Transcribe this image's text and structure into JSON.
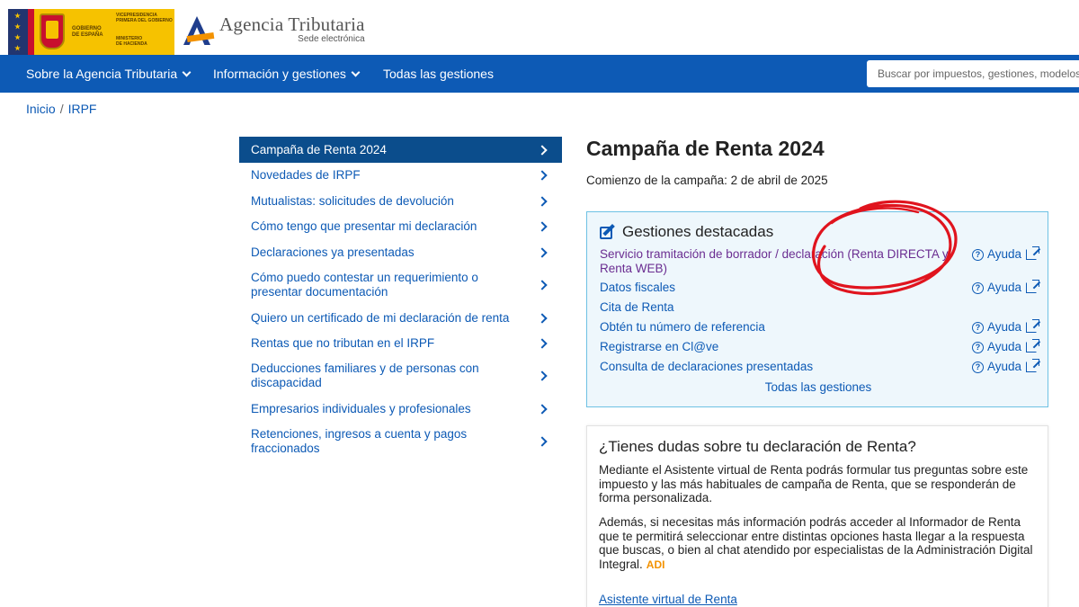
{
  "header": {
    "gov_logo": {
      "line1": "GOBIERNO",
      "line2": "DE ESPAÑA",
      "line3": "VICEPRESIDENCIA",
      "line4": "PRIMERA DEL GOBIERNO",
      "line5": "MINISTERIO",
      "line6": "DE HACIENDA"
    },
    "agency_name": "Agencia Tributaria",
    "agency_sub": "Sede electrónica"
  },
  "nav": {
    "items": [
      {
        "label": "Sobre la Agencia Tributaria",
        "has_dropdown": true
      },
      {
        "label": "Información y gestiones",
        "has_dropdown": true
      },
      {
        "label": "Todas las gestiones",
        "has_dropdown": false
      }
    ],
    "search_placeholder": "Buscar por impuestos, gestiones, modelos o c"
  },
  "breadcrumb": {
    "items": [
      "Inicio",
      "IRPF"
    ],
    "separator": "/"
  },
  "sidemenu": {
    "items": [
      {
        "label": "Campaña de Renta 2024",
        "active": true
      },
      {
        "label": "Novedades de IRPF"
      },
      {
        "label": "Mutualistas: solicitudes de devolución"
      },
      {
        "label": "Cómo tengo que presentar mi declaración"
      },
      {
        "label": "Declaraciones ya presentadas"
      },
      {
        "label": "Cómo puedo contestar un requerimiento o presentar documentación"
      },
      {
        "label": "Quiero un certificado de mi declaración de renta"
      },
      {
        "label": "Rentas que no tributan en el IRPF"
      },
      {
        "label": "Deducciones familiares y de personas con discapacidad"
      },
      {
        "label": "Empresarios individuales y profesionales"
      },
      {
        "label": "Retenciones, ingresos a cuenta y pagos fraccionados"
      }
    ]
  },
  "main": {
    "title": "Campaña de Renta 2024",
    "campaign_start": "Comienzo de la campaña: 2 de abril de 2025",
    "gestiones": {
      "heading": "Gestiones destacadas",
      "rows": [
        {
          "label": "Servicio tramitación de borrador / declaración (Renta DIRECTA y Renta WEB)",
          "help": "Ayuda",
          "visited": true
        },
        {
          "label": "Datos fiscales",
          "help": "Ayuda"
        },
        {
          "label": "Cita de Renta",
          "help": ""
        },
        {
          "label": "Obtén tu número de referencia",
          "help": "Ayuda"
        },
        {
          "label": "Registrarse en Cl@ve",
          "help": "Ayuda"
        },
        {
          "label": "Consulta de declaraciones presentadas",
          "help": "Ayuda"
        }
      ],
      "all_link": "Todas las gestiones"
    },
    "dudas": {
      "title": "¿Tienes dudas sobre tu declaración de Renta?",
      "p1": "Mediante el Asistente virtual de Renta podrás formular tus preguntas sobre este impuesto y las más habituales de campaña de Renta, que se responderán de forma personalizada.",
      "p2": "Además, si necesitas más información podrás acceder al Informador de Renta que te permitirá seleccionar entre distintas opciones hasta llegar a la respuesta que buscas, o bien al chat atendido por especialistas de la Administración Digital Integral.",
      "adi_logo": "ADI",
      "link": "Asistente virtual de Renta"
    }
  },
  "colors": {
    "nav_bg": "#0d5ab5",
    "active_menu_bg": "#0b4d8c",
    "link": "#0d5ab5",
    "visited_link": "#6a2d91",
    "gestiones_bg": "#eef7fc",
    "gestiones_border": "#6ec1e4",
    "annotation_red": "#e0141e"
  }
}
